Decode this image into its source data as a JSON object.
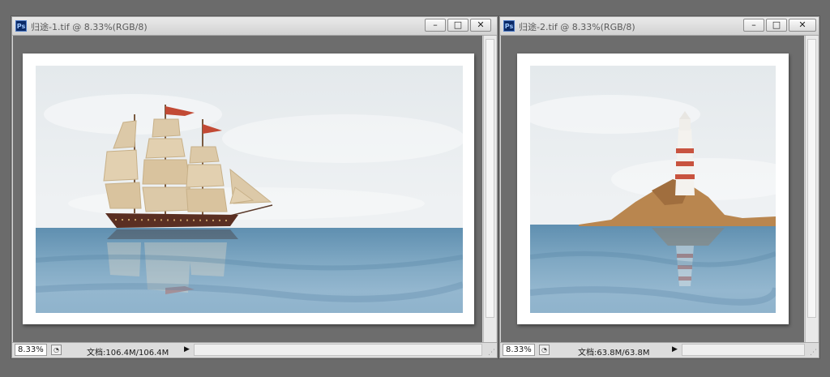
{
  "windows": [
    {
      "title": "归途-1.tif @ 8.33%(RGB/8)",
      "icon": "Ps",
      "controls": {
        "minimize": "–",
        "maximize": "□",
        "close": "✕"
      },
      "status": {
        "zoom": "8.33%",
        "doc_info": "文档:106.4M/106.4M",
        "arrow": "▶"
      }
    },
    {
      "title": "归途-2.tif @ 8.33%(RGB/8)",
      "icon": "Ps",
      "controls": {
        "minimize": "–",
        "maximize": "□",
        "close": "✕"
      },
      "status": {
        "zoom": "8.33%",
        "doc_info": "文档:63.8M/63.8M",
        "arrow": "▶"
      }
    }
  ],
  "colors": {
    "workspace": "#6b6b6b",
    "sea": "#6f9bbb",
    "sky": "#e8edf0",
    "sail": "#dcc9a8",
    "hull": "#5a2f22",
    "flag": "#c24a35",
    "lighthouse_stripe": "#c8533f",
    "rock": "#b9864f"
  }
}
